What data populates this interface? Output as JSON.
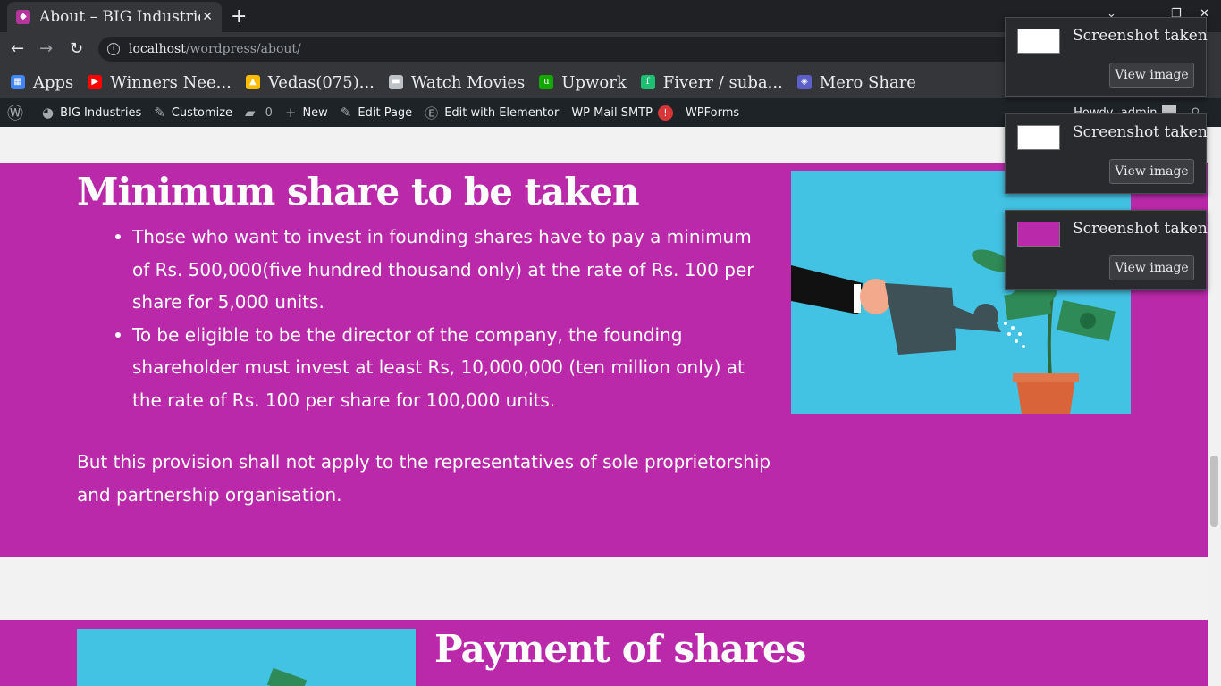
{
  "browser": {
    "tab_title": "About – BIG Industries",
    "url_host": "localhost",
    "url_path": "/wordpress/about/",
    "bookmarks": [
      {
        "label": "Apps",
        "icon": "apps-grid-icon",
        "color": "#4285f4"
      },
      {
        "label": "Winners Nee...",
        "icon": "youtube-icon",
        "color": "#ff0000"
      },
      {
        "label": "Vedas(075)...",
        "icon": "google-drive-icon",
        "color": "#fbbc04"
      },
      {
        "label": "Watch Movies",
        "icon": "folder-icon",
        "color": "#bdc1c6"
      },
      {
        "label": "Upwork",
        "icon": "upwork-icon",
        "color": "#14a800"
      },
      {
        "label": "Fiverr / suba...",
        "icon": "fiverr-icon",
        "color": "#1dbf73"
      },
      {
        "label": "Mero Share",
        "icon": "mero-share-icon",
        "color": "#5b5fc7"
      }
    ]
  },
  "admin_bar": {
    "site_name": "BIG Industries",
    "customize": "Customize",
    "comments_count": "0",
    "new": "New",
    "edit_page": "Edit Page",
    "edit_elementor": "Edit with Elementor",
    "wp_mail_smtp": "WP Mail SMTP",
    "smtp_badge": "!",
    "wpforms": "WPForms",
    "howdy": "Howdy, admin"
  },
  "content": {
    "section1_heading": "Minimum share to be taken",
    "bullets": [
      "Those who want to invest in founding shares have to pay a minimum of Rs. 500,000(five hundred thousand only) at the rate of Rs. 100 per share for 5,000 units.",
      "To be eligible to be the director of the company, the founding shareholder must invest at least Rs, 10,000,000 (ten million only) at the rate of Rs. 100 per share for 100,000 units."
    ],
    "paragraph": "But this provision shall not apply to the representatives of sole proprietorship and partnership organisation.",
    "section2_heading": "Payment of shares"
  },
  "notifications": [
    {
      "title": "Screenshot taken",
      "button": "View image"
    },
    {
      "title": "Screenshot taken",
      "button": "View image"
    },
    {
      "title": "Screenshot taken",
      "button": "View image"
    }
  ],
  "colors": {
    "section_bg": "#ba29aa",
    "illustration_bg": "#43c3e3"
  }
}
